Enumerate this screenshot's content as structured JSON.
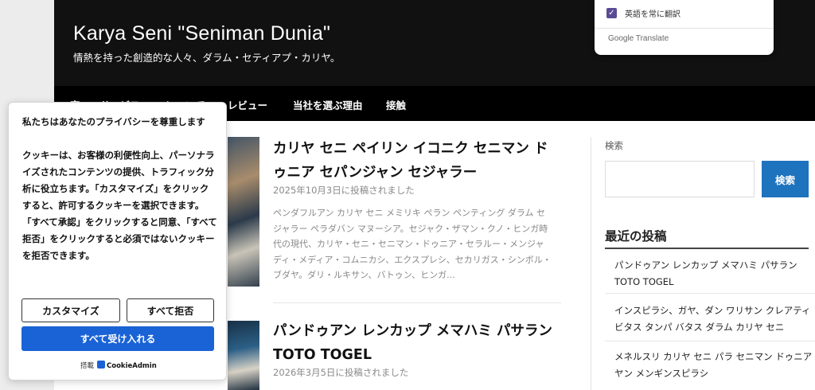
{
  "header": {
    "site_title": "Karya Seni \"Seniman Dunia\"",
    "tagline": "情熱を持った創造的な人々、ダラム・セティアプ・カリヤ。"
  },
  "nav": {
    "items": [
      "家",
      "サービス",
      "について",
      "レビュー",
      "当社を選ぶ理由",
      "接触"
    ]
  },
  "posts": [
    {
      "title": "カリヤ セニ ペイリン イコニク セニマン ドゥニア セパンジャン セジャラー",
      "date": "2025年10月3日に投稿されました",
      "excerpt": "ペンダフルアン カリヤ セニ メミリキ ペラン ペンティング ダラム セジャラー ペラダバン マヌーシア。セジャク・ザマン・クノ・ヒンガ時代の現代、カリヤ・セニ・セニマン・ドゥニア・セラルー・メンジャディ・メディア・コムニカシ、エクスプレシ、セカリガス・シンボル・ブダヤ。ダリ・ルキサン、バトゥン、ヒンガ..."
    },
    {
      "title": "パンドゥアン レンカップ メマハミ パサラン TOTO TOGEL",
      "date": "2026年3月5日に投稿されました"
    }
  ],
  "sidebar": {
    "search_label": "検索",
    "search_value": "",
    "search_button": "検索",
    "recent_heading": "最近の投稿",
    "recent_posts": [
      "パンドゥアン レンカップ メマハミ パサラン TOTO TOGEL",
      "インスピラシ、ガヤ、ダン ワリサン クレアティビタス タンパ バタス ダラム カリヤ セニ",
      "メネルスリ カリヤ セニ パラ セニマン ドゥニア ヤン メンギンスピラシ"
    ]
  },
  "translate_popup": {
    "checkbox_label": "英語を常に翻訳",
    "checked": true,
    "brand": "Google Translate"
  },
  "cookie": {
    "title": "私たちはあなたのプライバシーを尊重します",
    "body": "クッキーは、お客様の利便性向上、パーソナライズされたコンテンツの提供、トラフィック分析に役立ちます。「カスタマイズ」をクリックすると、許可するクッキーを選択できます。「すべて承認」をクリックすると同意、「すべて拒否」をクリックすると必須ではないクッキーを拒否できます。",
    "customize_button": "カスタマイズ",
    "reject_button": "すべて拒否",
    "accept_button": "すべて受け入れる",
    "powered_by": "搭載",
    "brand": "CookieAdmin"
  },
  "colors": {
    "header_bg": "#111111",
    "nav_bg": "#000000",
    "accent_blue": "#1e73be",
    "cookie_accept_blue": "#1a63d6",
    "checkbox_purple": "#5a4b96"
  }
}
